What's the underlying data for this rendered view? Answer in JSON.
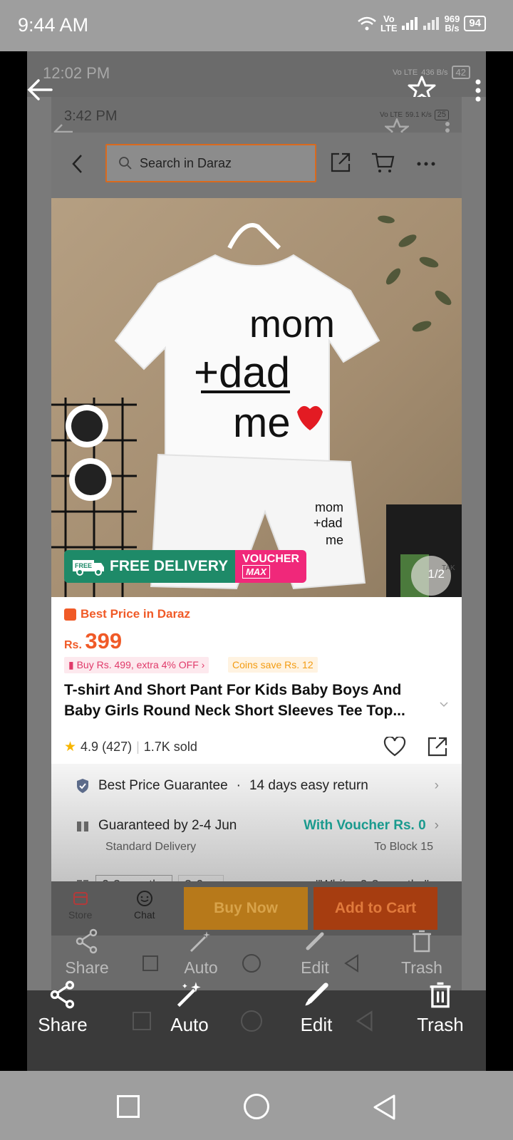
{
  "outer_status": {
    "time": "9:44 AM",
    "net_top": "Vo",
    "net_bottom": "LTE",
    "speed_top": "969",
    "speed_bottom": "B/s",
    "battery": "94"
  },
  "layer2_status": {
    "time": "12:02 PM",
    "net": "Vo LTE",
    "speed": "436 B/s",
    "battery": "42"
  },
  "layer3_status": {
    "time": "3:42 PM",
    "net": "Vo LTE",
    "speed": "59.1 K/s",
    "battery": "25"
  },
  "search": {
    "placeholder": "Search in Daraz"
  },
  "image": {
    "counter": "1/2",
    "shirt_line1": "mom",
    "shirt_line2": "+dad",
    "shirt_line3": "me",
    "badge_free": "FREE",
    "badge_delivery": "FREE DELIVERY",
    "badge_voucher_top": "VOUCHER",
    "badge_voucher_bottom": "MAX",
    "clapper_text": "TAK"
  },
  "product": {
    "best_price_label": "Best Price in Daraz",
    "price_currency": "Rs.",
    "price_value": "399",
    "promo_buy": "Buy Rs. 499, extra 4% OFF",
    "promo_coins": "Coins save Rs. 12",
    "title": "T-shirt And Short Pant For Kids Baby Boys And Baby Girls Round Neck Short Sleeves Tee Top...",
    "rating": "4.9 (427)",
    "sold": "1.7K sold"
  },
  "services": {
    "guarantee": "Best Price Guarantee",
    "return": "14 days easy return",
    "delivery": "Guaranteed by 2-4 Jun",
    "voucher": "With Voucher Rs. 0",
    "delivery_type": "Standard Delivery",
    "delivery_to": "To Block 15",
    "variant1": "0-3 months",
    "variant2": "3-6 ...",
    "variant_selected": "\"White, 0-3 months\""
  },
  "actions": {
    "store": "Store",
    "chat": "Chat",
    "buy_now": "Buy Now",
    "add_to_cart": "Add to Cart"
  },
  "gallery_actions": {
    "share": "Share",
    "auto": "Auto",
    "edit": "Edit",
    "trash": "Trash"
  }
}
